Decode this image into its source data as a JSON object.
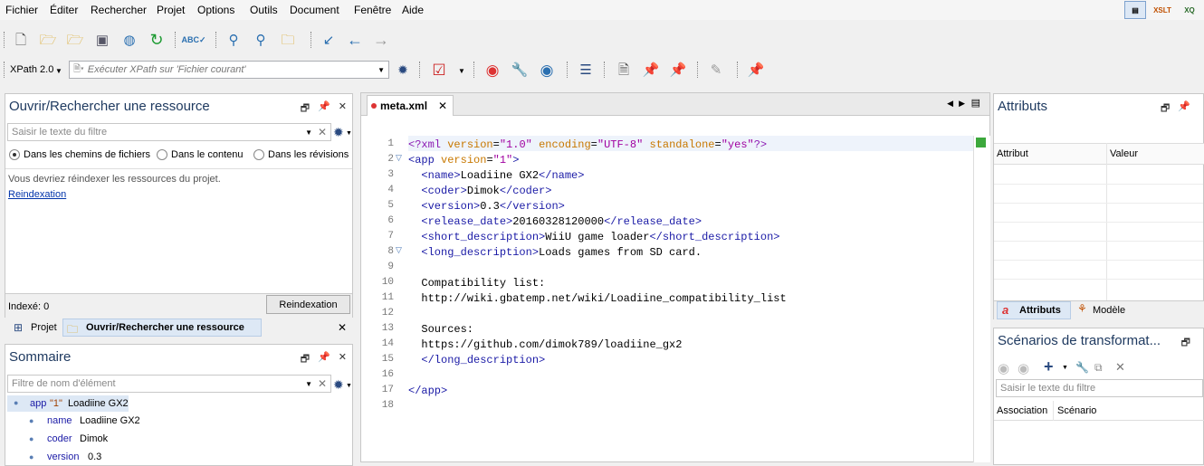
{
  "menu": [
    "Fichier",
    "Éditer",
    "Rechercher",
    "Projet",
    "Options",
    "Outils",
    "Document",
    "Fenêtre",
    "Aide"
  ],
  "perspectives": {
    "editor": "▤",
    "xslt": "XSLT",
    "xq": "XQ"
  },
  "xpath": {
    "version": "XPath 2.0",
    "placeholder": "Exécuter XPath sur  'Fichier courant'"
  },
  "open_panel": {
    "title": "Ouvrir/Rechercher une ressource",
    "filter_placeholder": "Saisir le texte du filtre",
    "radio_paths": "Dans les chemins de fichiers",
    "radio_content": "Dans le contenu",
    "radio_revisions": "Dans les révisions",
    "message": "Vous devriez réindexer les ressources du projet.",
    "reindex_link": "Reindexation",
    "indexed": "Indexé: 0",
    "reindex_button": "Reindexation"
  },
  "bottom_tabs": {
    "projet": "Projet",
    "open": "Ouvrir/Rechercher une ressource"
  },
  "outline": {
    "title": "Sommaire",
    "filter_placeholder": "Filtre de nom d'élément",
    "root": {
      "name": "app",
      "attr": "\"1\"",
      "text": "Loadiine GX2"
    },
    "items": [
      {
        "name": "name",
        "value": "Loadiine GX2"
      },
      {
        "name": "coder",
        "value": "Dimok"
      },
      {
        "name": "version",
        "value": "0.3"
      }
    ]
  },
  "editor": {
    "tab": "meta.xml",
    "lines": [
      {
        "n": "1",
        "code": "<?xml version=\"1.0\" encoding=\"UTF-8\" standalone=\"yes\"?>"
      },
      {
        "n": "2",
        "code": "<app version=\"1\">"
      },
      {
        "n": "3",
        "code": "  <name>Loadiine GX2</name>"
      },
      {
        "n": "4",
        "code": "  <coder>Dimok</coder>"
      },
      {
        "n": "5",
        "code": "  <version>0.3</version>"
      },
      {
        "n": "6",
        "code": "  <release_date>20160328120000</release_date>"
      },
      {
        "n": "7",
        "code": "  <short_description>WiiU game loader</short_description>"
      },
      {
        "n": "8",
        "code": "  <long_description>Loads games from SD card."
      },
      {
        "n": "9",
        "code": ""
      },
      {
        "n": "10",
        "code": "  Compatibility list:"
      },
      {
        "n": "11",
        "code": "  http://wiki.gbatemp.net/wiki/Loadiine_compatibility_list"
      },
      {
        "n": "12",
        "code": ""
      },
      {
        "n": "13",
        "code": "  Sources:"
      },
      {
        "n": "14",
        "code": "  https://github.com/dimok789/loadiine_gx2"
      },
      {
        "n": "15",
        "code": "  </long_description>"
      },
      {
        "n": "16",
        "code": ""
      },
      {
        "n": "17",
        "code": "</app>"
      },
      {
        "n": "18",
        "code": ""
      }
    ]
  },
  "attributes_panel": {
    "title": "Attributs",
    "col_attr": "Attribut",
    "col_val": "Valeur",
    "tab_attr": "Attributs",
    "tab_model": "Modèle"
  },
  "scenarios_panel": {
    "title": "Scénarios de transformat...",
    "filter_placeholder": "Saisir le texte du filtre",
    "col_assoc": "Association",
    "col_scen": "Scénario"
  },
  "colors": {
    "title": "#1f3a60",
    "accent": "#d33",
    "tag": "#1a1aa6",
    "attr": "#c87800",
    "value": "#a000a0"
  }
}
